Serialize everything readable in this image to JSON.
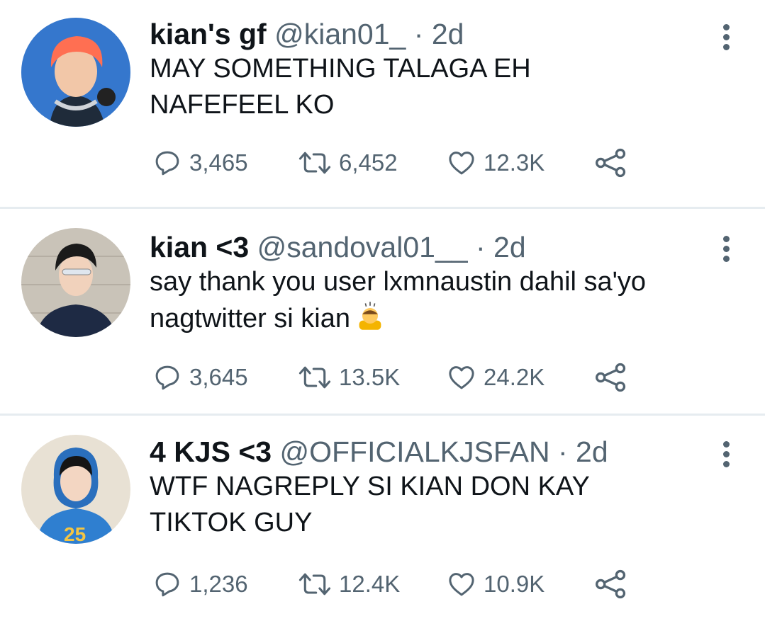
{
  "colors": {
    "text": "#0f1419",
    "secondary": "#536471",
    "divider": "#e6ecf0"
  },
  "tweets": [
    {
      "name": "kian's gf",
      "handle": "@kian01_",
      "dot": "·",
      "time": "2d",
      "text": "MAY SOMETHING TALAGA EH\nNAFEFEEL KO",
      "replies": "3,465",
      "retweets": "6,452",
      "likes": "12.3K"
    },
    {
      "name": "kian <3",
      "handle": "@sandoval01__",
      "dot": "·",
      "time": "2d",
      "text": "say thank you user lxmnaustin dahil sa'yo\nnagtwitter si kian",
      "emoji": "person-bowing-emoji",
      "replies": "3,645",
      "retweets": "13.5K",
      "likes": "24.2K"
    },
    {
      "name": "4 KJS <3",
      "handle": "@OFFICIALKJSFAN",
      "dot": "·",
      "time": "2d",
      "text": "WTF NAGREPLY SI KIAN DON KAY\nTIKTOK GUY",
      "replies": "1,236",
      "retweets": "12.4K",
      "likes": "10.9K"
    }
  ],
  "icons": [
    "more-vertical-icon",
    "reply-icon",
    "retweet-icon",
    "like-icon",
    "share-icon"
  ]
}
